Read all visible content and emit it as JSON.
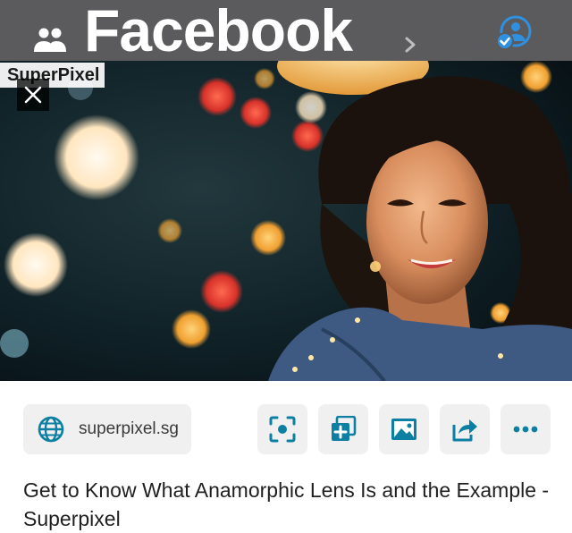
{
  "header": {
    "brand": "Facebook",
    "accent": "#1f8fe0",
    "bar_color": "#5b5b5d",
    "icons": [
      "people-icon",
      "chevron-right-icon",
      "account-switch-icon"
    ]
  },
  "hero": {
    "source_label": "SuperPixel",
    "icons": [
      "close-icon"
    ]
  },
  "actions": {
    "domain": "superpixel.sg",
    "icon_color": "#0d7fa3",
    "icons": [
      "globe-icon",
      "visual-search-icon",
      "add-to-collection-icon",
      "image-icon",
      "share-icon",
      "more-icon"
    ]
  },
  "caption": {
    "title": "Get to Know What Anamorphic Lens Is and the Example - Superpixel"
  }
}
